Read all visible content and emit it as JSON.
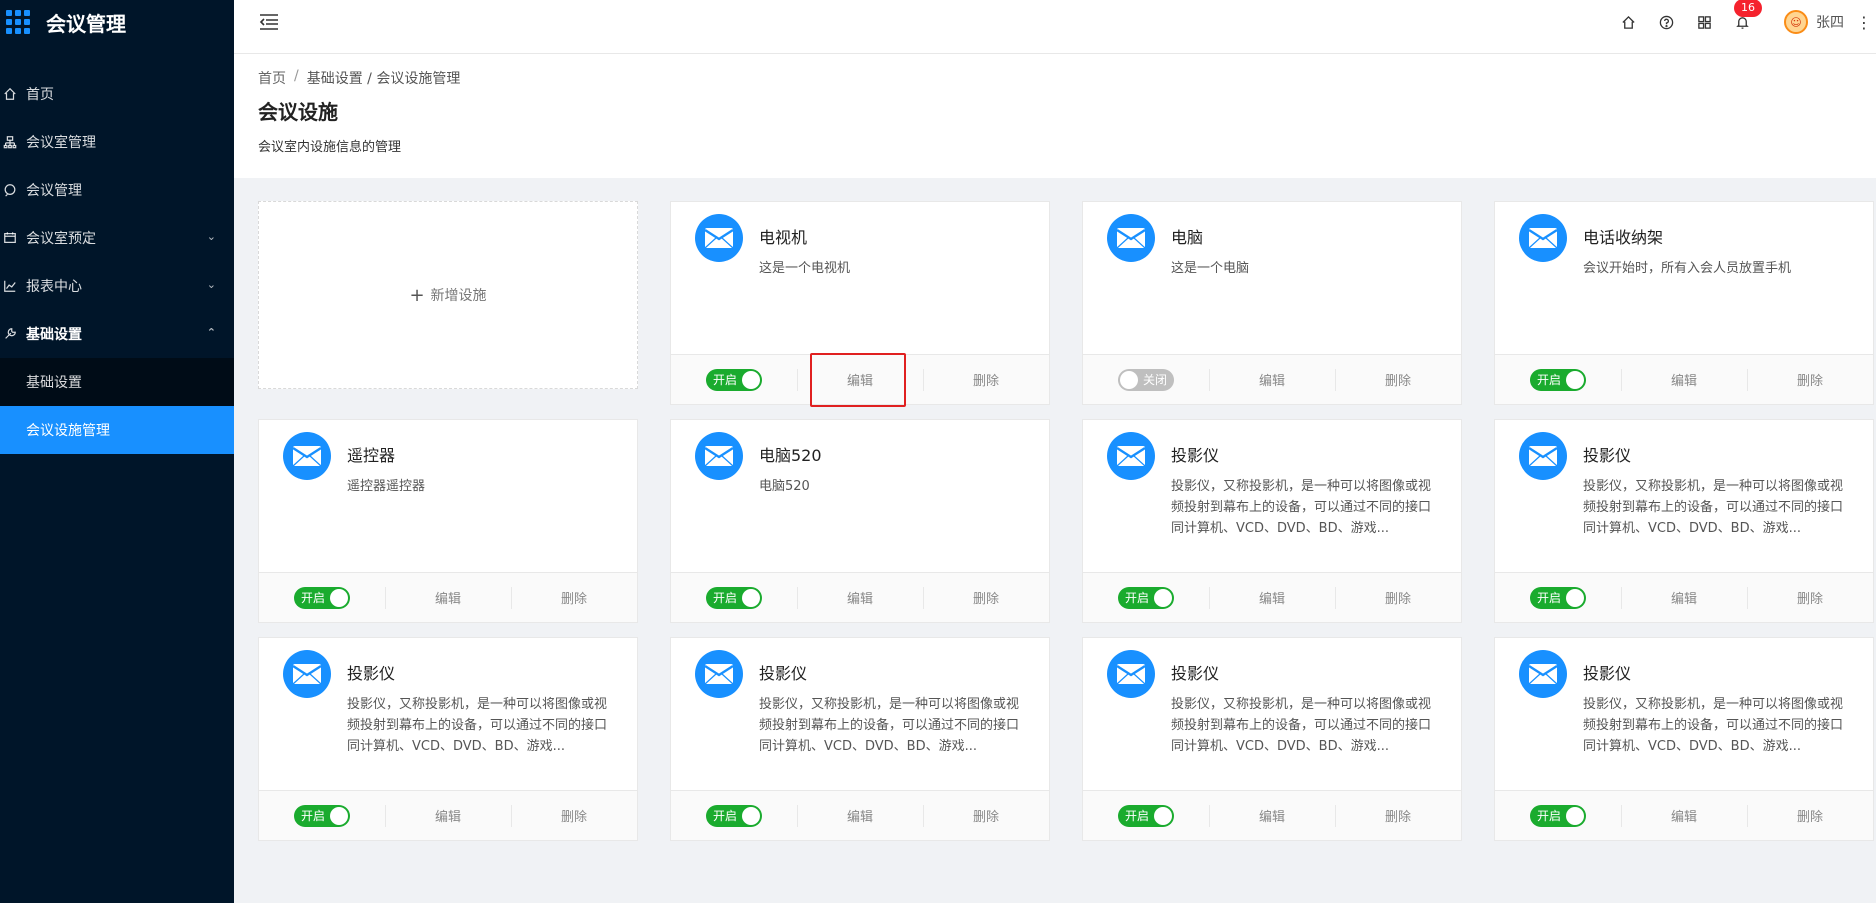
{
  "app": {
    "title": "会议管理"
  },
  "sidebar": {
    "items": [
      {
        "label": "首页",
        "icon": "home-icon"
      },
      {
        "label": "会议室管理",
        "icon": "building-icon"
      },
      {
        "label": "会议管理",
        "icon": "chat-icon"
      },
      {
        "label": "会议室预定",
        "icon": "calendar-icon",
        "arrow": "⌄"
      },
      {
        "label": "报表中心",
        "icon": "chart-icon",
        "arrow": "⌄"
      },
      {
        "label": "基础设置",
        "icon": "wrench-icon",
        "arrow": "⌃"
      }
    ],
    "submenu": [
      {
        "label": "基础设置"
      },
      {
        "label": "会议设施管理"
      }
    ]
  },
  "header": {
    "notification_count": "16",
    "username": "张四",
    "avatar_text": "☺",
    "more": "⋮"
  },
  "breadcrumb": {
    "home": "首页",
    "sep": "/",
    "current": "基础设置 / 会议设施管理"
  },
  "page": {
    "title": "会议设施",
    "description": "会议室内设施信息的管理"
  },
  "add_card": {
    "plus": "+",
    "label": "新增设施"
  },
  "actions": {
    "edit": "编辑",
    "delete": "删除",
    "on": "开启",
    "off": "关闭"
  },
  "cards": [
    {
      "title": "电视机",
      "desc": "这是一个电视机",
      "enabled": true
    },
    {
      "title": "电脑",
      "desc": "这是一个电脑",
      "enabled": false
    },
    {
      "title": "电话收纳架",
      "desc": "会议开始时，所有入会人员放置手机",
      "enabled": true
    },
    {
      "title": "遥控器",
      "desc": "遥控器遥控器",
      "enabled": true
    },
    {
      "title": "电脑520",
      "desc": "电脑520",
      "enabled": true
    },
    {
      "title": "投影仪",
      "desc": "投影仪，又称投影机，是一种可以将图像或视频投射到幕布上的设备，可以通过不同的接口同计算机、VCD、DVD、BD、游戏...",
      "enabled": true
    },
    {
      "title": "投影仪",
      "desc": "投影仪，又称投影机，是一种可以将图像或视频投射到幕布上的设备，可以通过不同的接口同计算机、VCD、DVD、BD、游戏...",
      "enabled": true
    },
    {
      "title": "投影仪",
      "desc": "投影仪，又称投影机，是一种可以将图像或视频投射到幕布上的设备，可以通过不同的接口同计算机、VCD、DVD、BD、游戏...",
      "enabled": true
    },
    {
      "title": "投影仪",
      "desc": "投影仪，又称投影机，是一种可以将图像或视频投射到幕布上的设备，可以通过不同的接口同计算机、VCD、DVD、BD、游戏...",
      "enabled": true
    },
    {
      "title": "投影仪",
      "desc": "投影仪，又称投影机，是一种可以将图像或视频投射到幕布上的设备，可以通过不同的接口同计算机、VCD、DVD、BD、游戏...",
      "enabled": true
    },
    {
      "title": "投影仪",
      "desc": "投影仪，又称投影机，是一种可以将图像或视频投射到幕布上的设备，可以通过不同的接口同计算机、VCD、DVD、BD、游戏...",
      "enabled": true
    }
  ],
  "colors": {
    "primary": "#1890ff",
    "sidebar": "#001529",
    "switch_on": "#1aab2e",
    "switch_off": "#bfbfbf",
    "highlight": "#e02020"
  }
}
